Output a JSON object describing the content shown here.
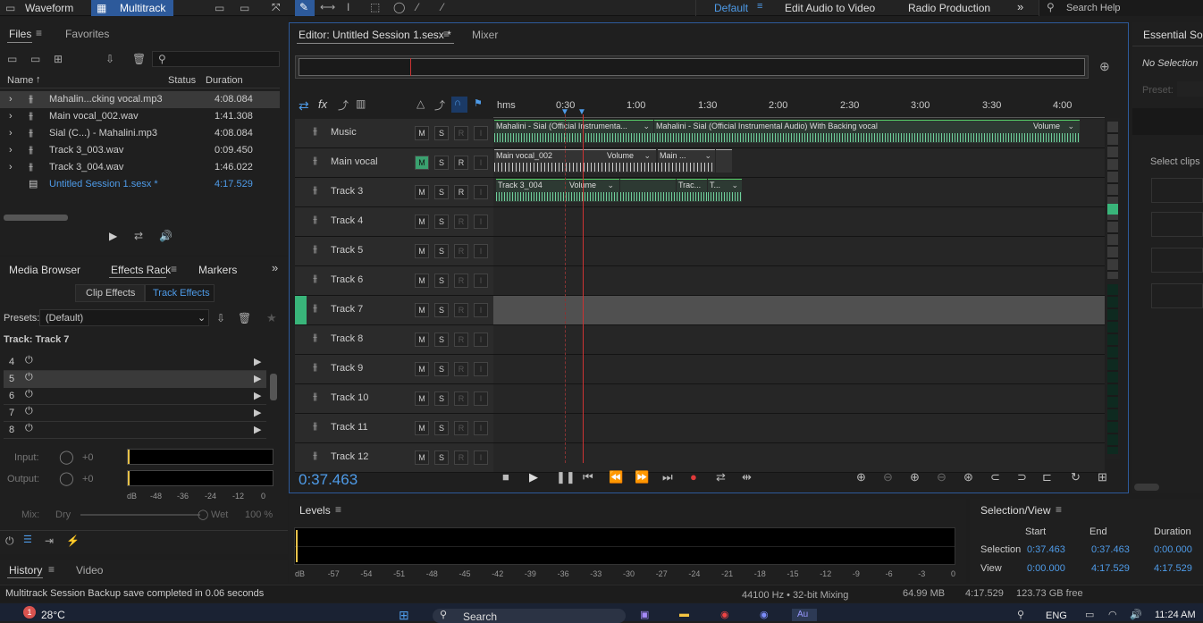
{
  "top": {
    "waveform": "Waveform",
    "multitrack": "Multitrack",
    "workspaces": [
      "Default",
      "Edit Audio to Video",
      "Radio Production"
    ],
    "search_placeholder": "Search Help"
  },
  "files": {
    "tab_files": "Files",
    "tab_favorites": "Favorites",
    "col_name": "Name",
    "col_status": "Status",
    "col_duration": "Duration",
    "rows": [
      {
        "name": "Mahalin...cking vocal.mp3",
        "duration": "4:08.084"
      },
      {
        "name": "Main vocal_002.wav",
        "duration": "1:41.308"
      },
      {
        "name": "Sial (C...) - Mahalini.mp3",
        "duration": "4:08.084"
      },
      {
        "name": "Track 3_003.wav",
        "duration": "0:09.450"
      },
      {
        "name": "Track 3_004.wav",
        "duration": "1:46.022"
      },
      {
        "name": "Untitled Session 1.sesx *",
        "duration": "4:17.529"
      }
    ]
  },
  "effects": {
    "tab_media": "Media Browser",
    "tab_rack": "Effects Rack",
    "tab_markers": "Markers",
    "clip_effects": "Clip Effects",
    "track_effects": "Track Effects",
    "presets_label": "Presets:",
    "preset_value": "(Default)",
    "track_label": "Track: Track 7",
    "slots": [
      "4",
      "5",
      "6",
      "7",
      "8"
    ],
    "input_label": "Input:",
    "input_val": "+0",
    "output_label": "Output:",
    "output_val": "+0",
    "db_ticks": [
      "dB",
      "-48",
      "-36",
      "-24",
      "-12",
      "0"
    ],
    "mix_label": "Mix:",
    "dry": "Dry",
    "wet": "Wet",
    "wet_pct": "100 %"
  },
  "history": {
    "tab_history": "History",
    "tab_video": "Video"
  },
  "editor": {
    "tab": "Editor: Untitled Session 1.sesx *",
    "mixer": "Mixer",
    "ruler": [
      "hms",
      "0:30",
      "1:00",
      "1:30",
      "2:00",
      "2:30",
      "3:00",
      "3:30",
      "4:00"
    ],
    "tracks": [
      {
        "name": "Music",
        "m_on": false,
        "r_dim": true
      },
      {
        "name": "Main vocal",
        "m_on": true,
        "r_dim": false
      },
      {
        "name": "Track 3",
        "m_on": false,
        "r_dim": false
      },
      {
        "name": "Track 4",
        "m_on": false,
        "r_dim": true
      },
      {
        "name": "Track 5",
        "m_on": false,
        "r_dim": true
      },
      {
        "name": "Track 6",
        "m_on": false,
        "r_dim": true
      },
      {
        "name": "Track 7",
        "m_on": false,
        "r_dim": true
      },
      {
        "name": "Track 8",
        "m_on": false,
        "r_dim": true
      },
      {
        "name": "Track 9",
        "m_on": false,
        "r_dim": true
      },
      {
        "name": "Track 10",
        "m_on": false,
        "r_dim": true
      },
      {
        "name": "Track 11",
        "m_on": false,
        "r_dim": true
      },
      {
        "name": "Track 12",
        "m_on": false,
        "r_dim": true
      }
    ],
    "clips": {
      "music_1": "Mahalini - Sial (Official Instrumenta...",
      "music_2": "Mahalini - Sial (Official Instrumental Audio) With Backing vocal",
      "music_vol": "Volume",
      "vocal_1": "Main vocal_002",
      "vocal_vol": "Volume",
      "vocal_2": "Main ...",
      "t3_1": "Track 3_004",
      "t3_vol": "Volume",
      "t3_2": "Trac...",
      "t3_3": "T..."
    },
    "time": "0:37.463",
    "btn_labels": {
      "m": "M",
      "s": "S",
      "r": "R",
      "i": "I"
    }
  },
  "essential": {
    "title": "Essential Sou",
    "no_selection": "No Selection",
    "preset": "Preset:",
    "select_clips": "Select clips"
  },
  "levels": {
    "title": "Levels",
    "ticks": [
      "dB",
      "-57",
      "-54",
      "-51",
      "-48",
      "-45",
      "-42",
      "-39",
      "-36",
      "-33",
      "-30",
      "-27",
      "-24",
      "-21",
      "-18",
      "-15",
      "-12",
      "-9",
      "-6",
      "-3",
      "0"
    ]
  },
  "selview": {
    "title": "Selection/View",
    "start": "Start",
    "end": "End",
    "duration": "Duration",
    "selection_label": "Selection",
    "view_label": "View",
    "sel_start": "0:37.463",
    "sel_end": "0:37.463",
    "sel_dur": "0:00.000",
    "view_start": "0:00.000",
    "view_end": "4:17.529",
    "view_dur": "4:17.529"
  },
  "status": {
    "message": "Multitrack Session Backup save completed in 0.06 seconds",
    "rate": "44100 Hz • 32-bit Mixing",
    "mem": "64.99 MB",
    "length": "4:17.529",
    "free": "123.73 GB free"
  },
  "taskbar": {
    "temp": "28°C",
    "search": "Search",
    "lang": "ENG",
    "clock": "11:24 AM",
    "weather_badge": "1"
  },
  "colors": {
    "accent": "#4e9be8",
    "wave": "#6fd09c",
    "active_tab": "#2d5a9b",
    "record": "#e03a3a"
  }
}
